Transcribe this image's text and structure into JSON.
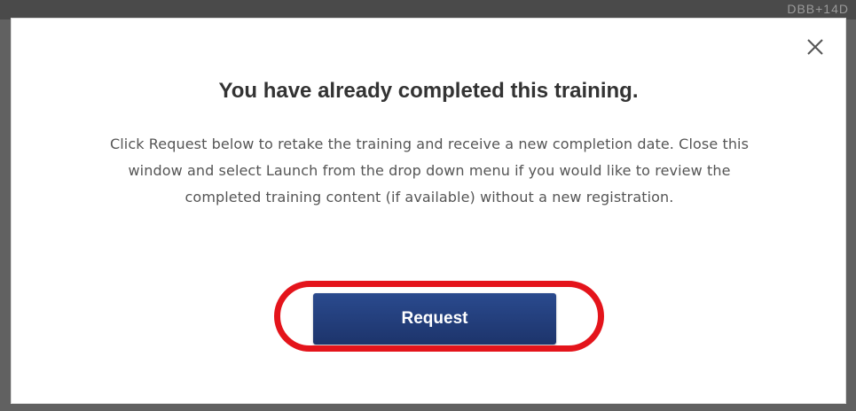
{
  "background": {
    "corner_text": "DBB+14D"
  },
  "modal": {
    "title": "You have already completed this training.",
    "message": "Click Request below to retake the training and receive a new completion date. Close this window and select Launch from the drop down menu if you would like to review the completed training content (if available) without a new registration.",
    "close_icon": "close-icon",
    "request_label": "Request"
  },
  "colors": {
    "button": "#1d346b",
    "highlight": "#e4141b",
    "title": "#333333",
    "body_text": "#555555"
  }
}
